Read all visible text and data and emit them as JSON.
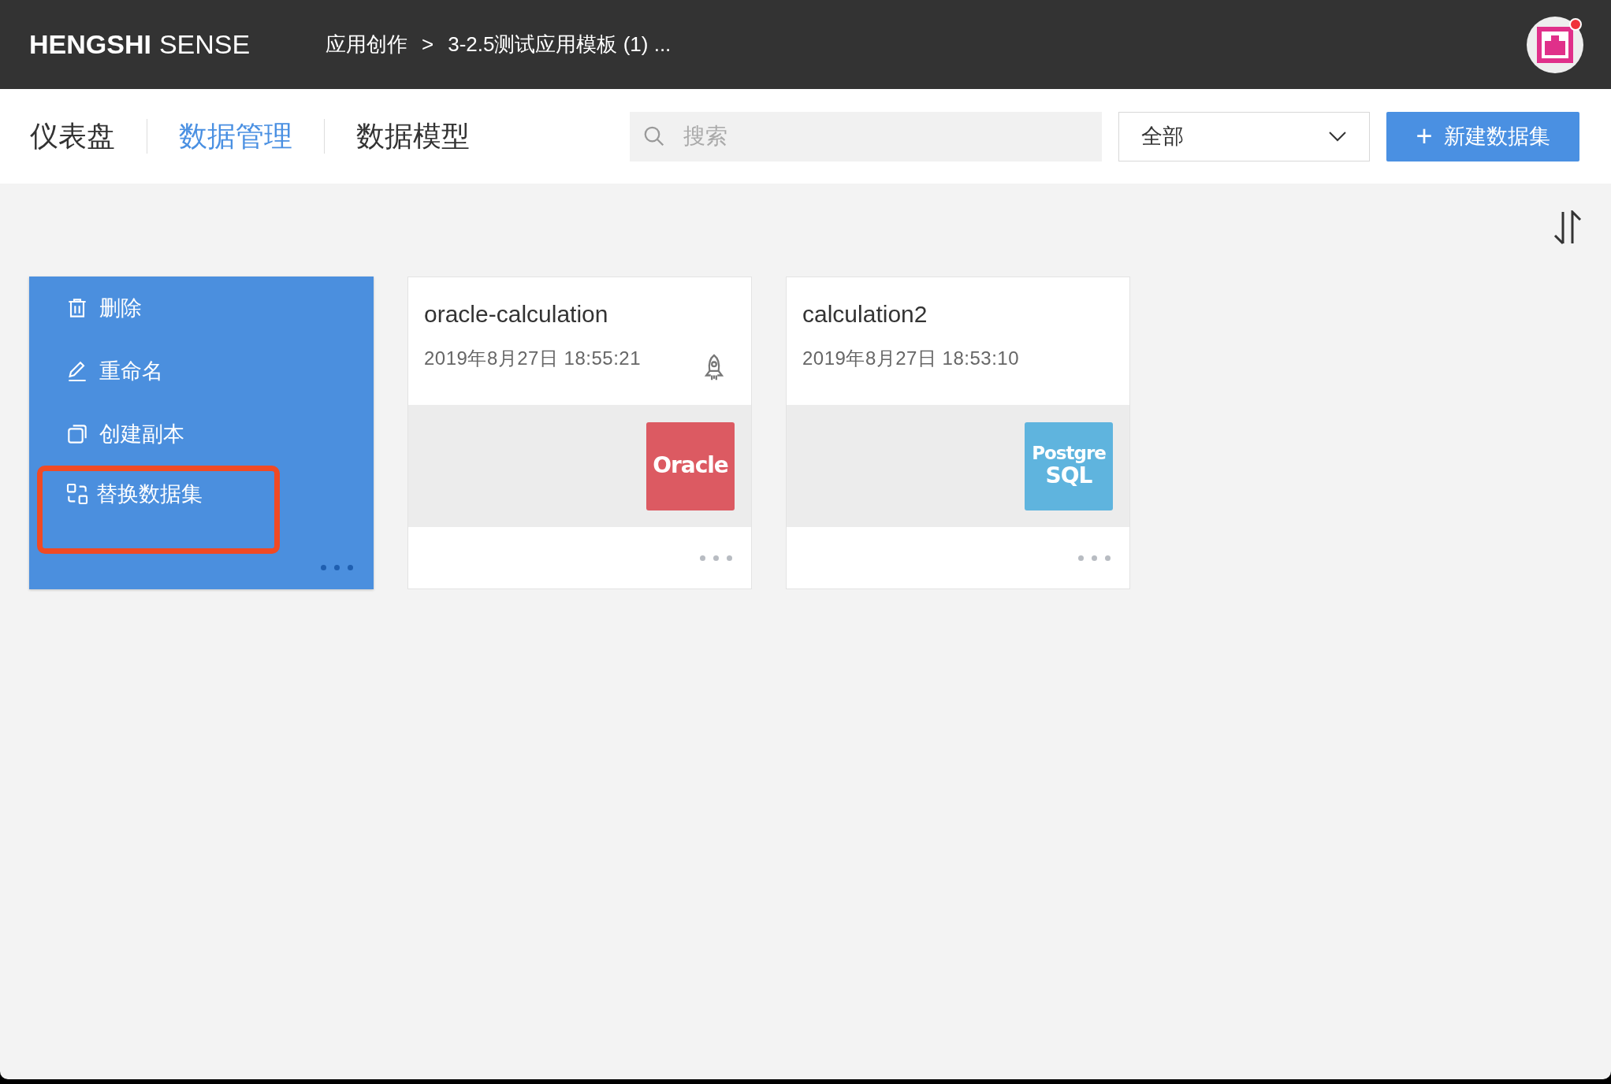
{
  "header": {
    "brand_bold": "HENGSHI",
    "brand_light": "SENSE",
    "breadcrumb": [
      "应用创作",
      ">",
      "3-2.5测试应用模板 (1) ..."
    ],
    "notification": true
  },
  "tabs": [
    {
      "label": "仪表盘",
      "selected": false
    },
    {
      "label": "数据管理",
      "selected": true
    },
    {
      "label": "数据模型",
      "selected": false
    }
  ],
  "search": {
    "placeholder": "搜索"
  },
  "filter": {
    "value": "全部"
  },
  "new_button": {
    "icon": "+",
    "label": "新建数据集"
  },
  "cards": [
    {
      "menu_open": true,
      "menu": [
        {
          "kind": "trash",
          "label": "删除",
          "highlighted": false
        },
        {
          "kind": "pencil",
          "label": "重命名",
          "highlighted": false
        },
        {
          "kind": "copy",
          "label": "创建副本",
          "highlighted": false
        },
        {
          "kind": "swap",
          "label": "替换数据集",
          "highlighted": true
        }
      ]
    },
    {
      "menu_open": false,
      "name": "oracle-calculation",
      "date": "2019年8月27日 18:55:21",
      "published": true,
      "logo": {
        "lines": [
          "Oracle"
        ],
        "color": "#dc5a62"
      }
    },
    {
      "menu_open": false,
      "name": "calculation2",
      "date": "2019年8月27日 18:53:10",
      "published": false,
      "logo": {
        "lines": [
          "Postgre",
          "SQL"
        ],
        "color": "#5fb4de"
      }
    }
  ]
}
